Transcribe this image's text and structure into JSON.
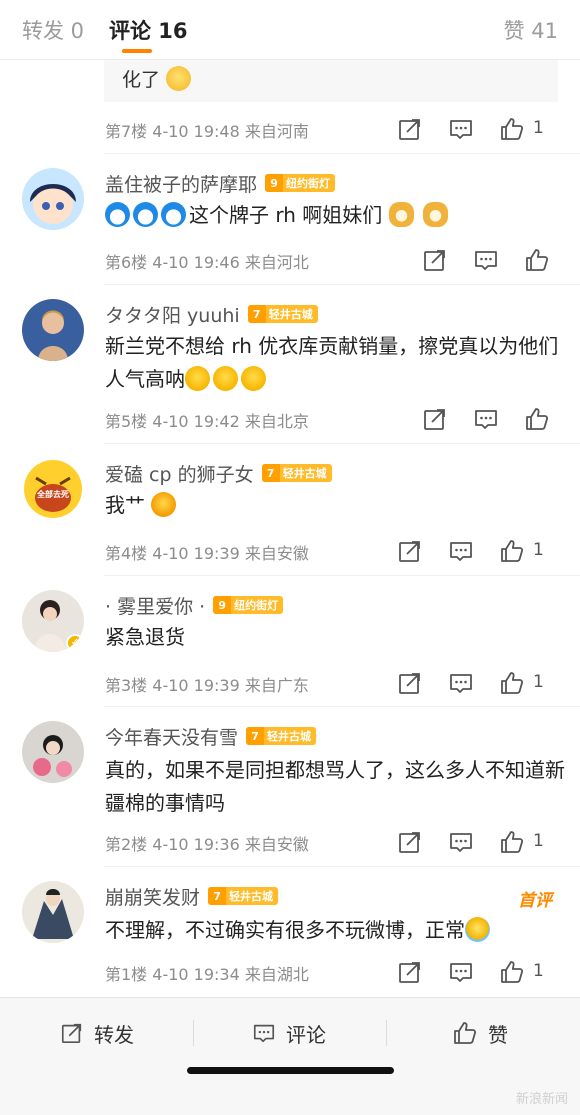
{
  "tabs": {
    "repost": "转发 0",
    "comments": "评论 16",
    "likes": "赞 41"
  },
  "prev_reply": {
    "text": "化了"
  },
  "comments": [
    {
      "floor": "第7楼",
      "time": "4-10 19:48",
      "location": "来自河南",
      "likes": "1"
    },
    {
      "username": "盖住被子的萨摩耶",
      "badge_level": "9",
      "badge_text": "纽约街灯",
      "text": "这个牌子 rh 啊姐妹们",
      "floor": "第6楼",
      "time": "4-10 19:46",
      "location": "来自河北",
      "likes": ""
    },
    {
      "username": "タタタ阳 yuuhi",
      "badge_level": "7",
      "badge_text": "轻井古城",
      "text": "新兰党不想给 rh 优衣库贡献销量，擦党真以为他们人气高呐",
      "floor": "第5楼",
      "time": "4-10 19:42",
      "location": "来自北京",
      "likes": ""
    },
    {
      "username": "爱磕 cp 的狮子女",
      "badge_level": "7",
      "badge_text": "轻井古城",
      "text": "我艹",
      "avatar_text": "全部去死",
      "floor": "第4楼",
      "time": "4-10 19:39",
      "location": "来自安徽",
      "likes": "1"
    },
    {
      "username": "· 雾里爱你 ·",
      "badge_level": "9",
      "badge_text": "纽约街灯",
      "text": "紧急退货",
      "floor": "第3楼",
      "time": "4-10 19:39",
      "location": "来自广东",
      "likes": "1"
    },
    {
      "username": "今年春天没有雪",
      "badge_level": "7",
      "badge_text": "轻井古城",
      "text": "真的，如果不是同担都想骂人了，这么多人不知道新疆棉的事情吗",
      "floor": "第2楼",
      "time": "4-10 19:36",
      "location": "来自安徽",
      "likes": "1"
    },
    {
      "username": "崩崩笑发财",
      "badge_level": "7",
      "badge_text": "轻井古城",
      "text": "不理解，不过确实有很多不玩微博，正常",
      "hot_label": "首评",
      "floor": "第1楼",
      "time": "4-10 19:34",
      "location": "来自湖北",
      "likes": "1"
    }
  ],
  "bottom_bar": {
    "repost": "转发",
    "comment": "评论",
    "like": "赞"
  },
  "watermark": "新浪新闻",
  "colors": {
    "accent": "#ff8200",
    "badge": "#ffbb2a",
    "verified": "#f7b500"
  },
  "icons": [
    "share-icon",
    "comment-icon",
    "like-icon",
    "laugh-emoji-icon",
    "doraemon-emoji-icon",
    "dog-emoji-icon",
    "verified-icon"
  ]
}
